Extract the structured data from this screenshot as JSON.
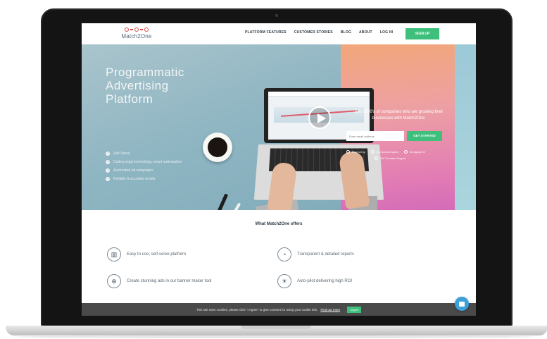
{
  "brand": {
    "name": "Match2One",
    "color": "#d94a4a"
  },
  "nav": {
    "links": [
      "PLATFORM FEATURES",
      "CUSTOMER STORIES",
      "BLOG",
      "ABOUT",
      "LOG IN"
    ],
    "signup_label": "SIGN UP"
  },
  "hero": {
    "title": "Programmatic Advertising Platform",
    "features": [
      "Self-Serve",
      "Cutting-edge technology, smart optimization",
      "Automated ad campaigns",
      "Reliable & accurate results"
    ],
    "join_text": "Join 1000's of companies who are growing their businesses with Match2One",
    "email_placeholder": "Enter email address",
    "cta_label": "GET STARTED",
    "options": [
      "Easy set up",
      "No minimum spend",
      "No signup fee",
      "24/7 Premium Support"
    ]
  },
  "offers": {
    "title": "What Match2One offers",
    "items": [
      {
        "icon": "platform-icon",
        "glyph": "▥",
        "text": "Easy to use, self-serve platform"
      },
      {
        "icon": "reports-icon",
        "glyph": "◔",
        "text": "Transparent & detailed reports"
      },
      {
        "icon": "banner-icon",
        "glyph": "⊕",
        "text": "Create stunning ads in our banner maker tool"
      },
      {
        "icon": "bulb-icon",
        "glyph": "☀",
        "text": "Auto-pilot delivering high ROI"
      }
    ]
  },
  "cookie": {
    "text": "This site uses cookies, please click \"I Agree\" to give consent for using your cookie info.",
    "link": "Find out more",
    "agree_label": "I Agree"
  },
  "colors": {
    "accent": "#3ec07c",
    "chat": "#3ea0d8",
    "cookie_bg": "#4a4a4a"
  }
}
